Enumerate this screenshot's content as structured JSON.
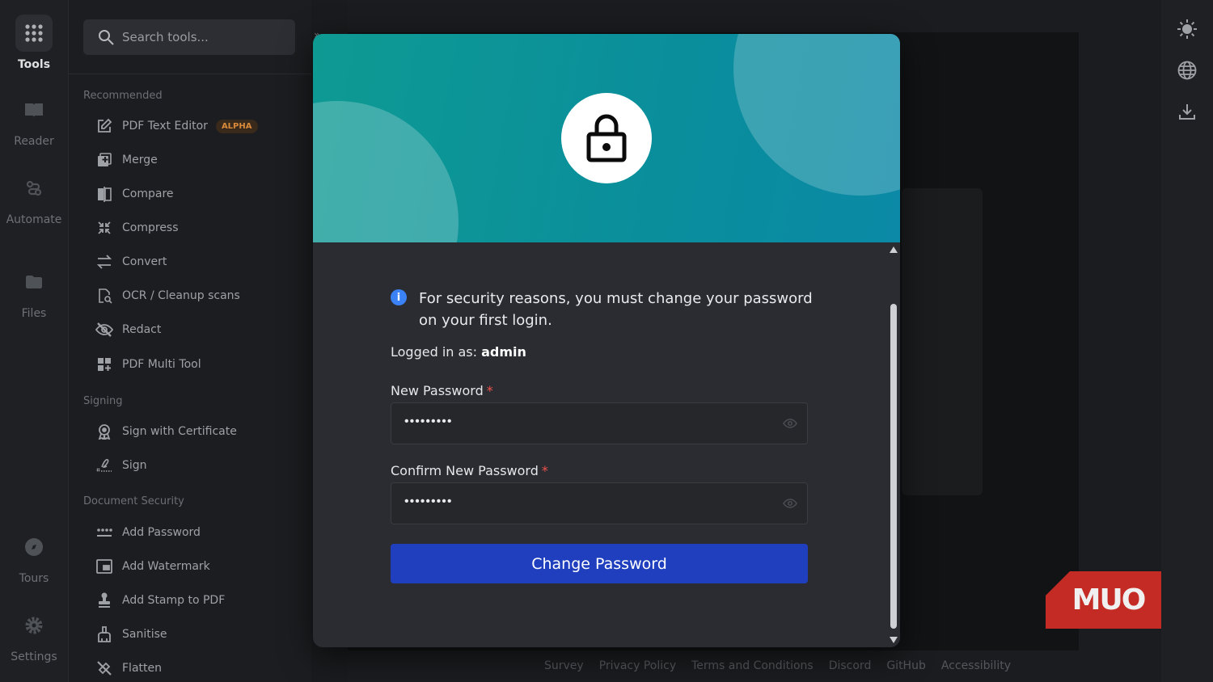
{
  "rail": [
    {
      "label": "Tools",
      "icon": "grid-icon",
      "active": true
    },
    {
      "label": "Reader",
      "icon": "book-icon"
    },
    {
      "label": "Automate",
      "icon": "automate-icon"
    },
    {
      "label": "Files",
      "icon": "folder-icon"
    },
    {
      "label": "Tours",
      "icon": "compass-icon"
    },
    {
      "label": "Settings",
      "icon": "gear-icon"
    }
  ],
  "search": {
    "placeholder": "Search tools..."
  },
  "sidebar": {
    "recommended_title": "Recommended",
    "recommended": [
      {
        "label": "PDF Text Editor",
        "icon": "edit-icon",
        "badge": "ALPHA"
      },
      {
        "label": "Merge",
        "icon": "merge-icon"
      },
      {
        "label": "Compare",
        "icon": "compare-icon"
      },
      {
        "label": "Compress",
        "icon": "compress-icon"
      },
      {
        "label": "Convert",
        "icon": "convert-icon"
      },
      {
        "label": "OCR / Cleanup scans",
        "icon": "ocr-icon"
      },
      {
        "label": "Redact",
        "icon": "redact-icon"
      },
      {
        "label": "PDF Multi Tool",
        "icon": "multi-tool-icon"
      }
    ],
    "signing_title": "Signing",
    "signing": [
      {
        "label": "Sign with Certificate",
        "icon": "certificate-icon"
      },
      {
        "label": "Sign",
        "icon": "signature-icon"
      }
    ],
    "security_title": "Document Security",
    "security": [
      {
        "label": "Add Password",
        "icon": "password-icon"
      },
      {
        "label": "Add Watermark",
        "icon": "watermark-icon"
      },
      {
        "label": "Add Stamp to PDF",
        "icon": "stamp-icon"
      },
      {
        "label": "Sanitise",
        "icon": "sanitise-icon"
      },
      {
        "label": "Flatten",
        "icon": "flatten-icon"
      }
    ]
  },
  "modal": {
    "info": "For security reasons, you must change your password on your first login.",
    "logged_prefix": "Logged in as:",
    "username": "admin",
    "new_label": "New Password",
    "new_value": "•••••••••",
    "confirm_label": "Confirm New Password",
    "confirm_value": "•••••••••",
    "required_mark": "*",
    "button": "Change Password"
  },
  "footer": [
    "Survey",
    "Privacy Policy",
    "Terms and Conditions",
    "Discord",
    "GitHub",
    "Accessibility"
  ],
  "right_rail": [
    "theme-sun-icon",
    "globe-icon",
    "download-icon"
  ],
  "watermark": "MUO",
  "colors": {
    "accent": "#1f3fbf",
    "hero": "#0e9a93",
    "info": "#3b82f6",
    "required": "#f0524c"
  }
}
